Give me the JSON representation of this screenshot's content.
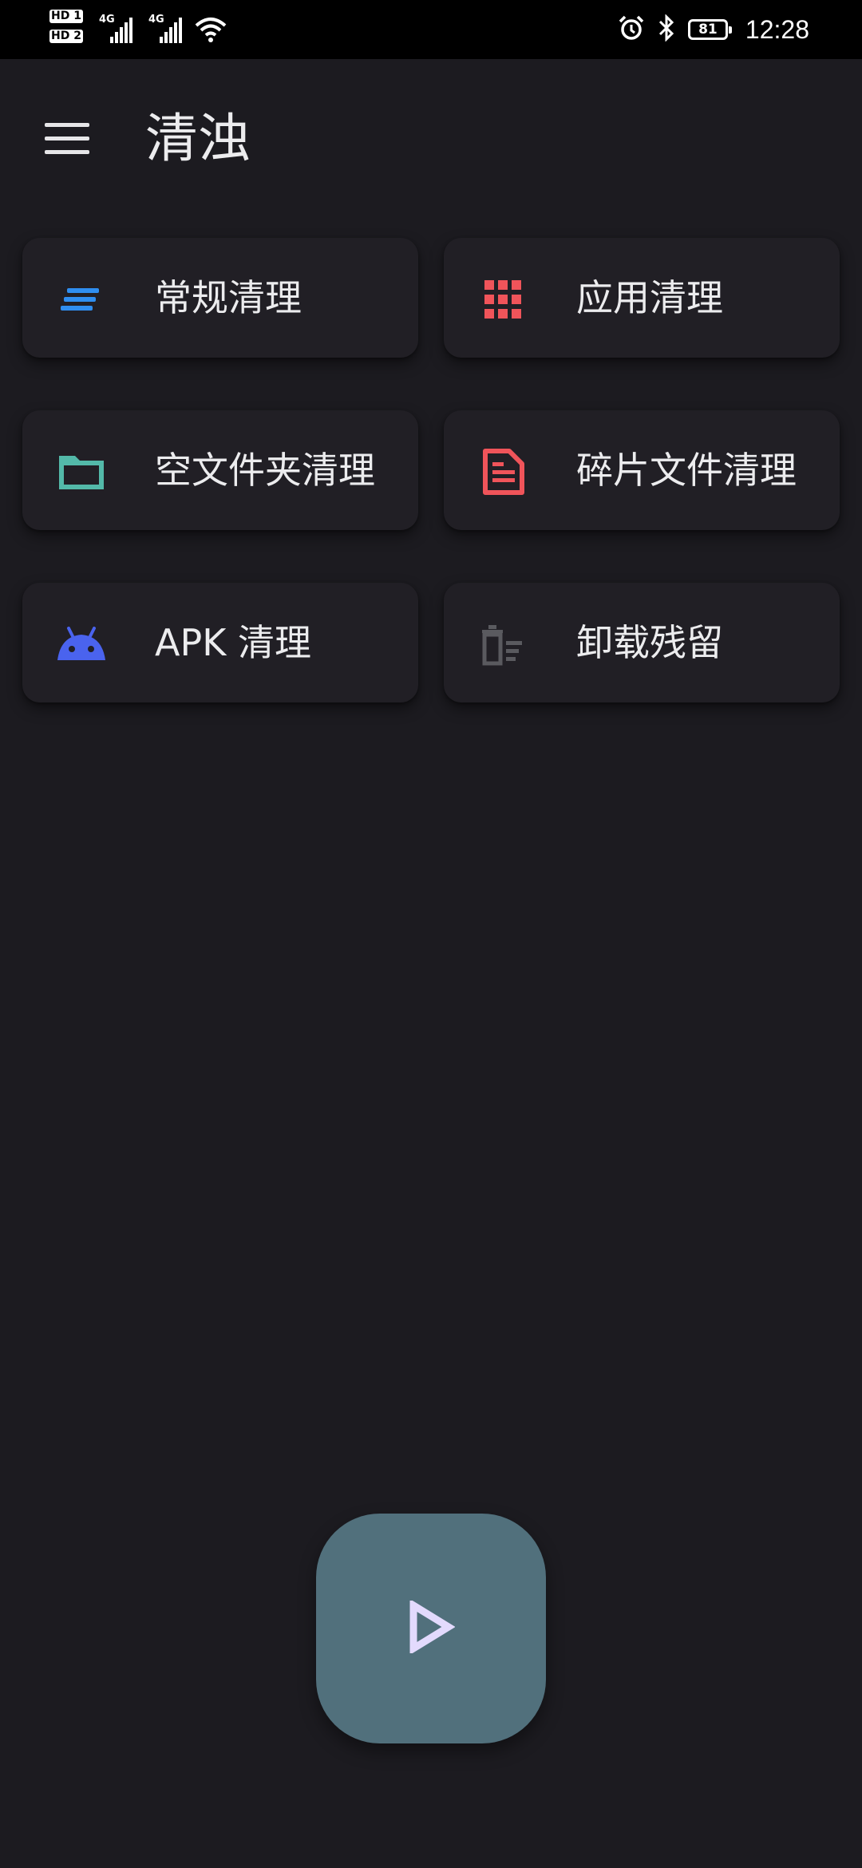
{
  "status_bar": {
    "sim1": "HD 1",
    "sim2": "HD 2",
    "network1": "4G",
    "network2": "4G",
    "battery_level": "81",
    "time": "12:28",
    "icons": [
      "signal-icon",
      "wifi-icon",
      "alarm-icon",
      "bluetooth-icon",
      "battery-icon"
    ]
  },
  "app_bar": {
    "title": "清浊",
    "menu_icon": "hamburger-menu-icon"
  },
  "clean_options": [
    {
      "label": "常规清理",
      "icon": "lines-icon",
      "color": "#2f8ef0"
    },
    {
      "label": "应用清理",
      "icon": "app-grid-icon",
      "color": "#f0545a"
    },
    {
      "label": "空文件夹清理",
      "icon": "folder-icon",
      "color": "#53b9a9"
    },
    {
      "label": "碎片文件清理",
      "icon": "document-icon",
      "color": "#f0545a"
    },
    {
      "label": "APK 清理",
      "icon": "android-icon",
      "color": "#4a63ee"
    },
    {
      "label": "卸载残留",
      "icon": "trash-list-icon",
      "color": "#5a5a5f"
    }
  ],
  "fab": {
    "icon": "play-icon",
    "background": "#51707c",
    "icon_color": "#e3dafd"
  }
}
